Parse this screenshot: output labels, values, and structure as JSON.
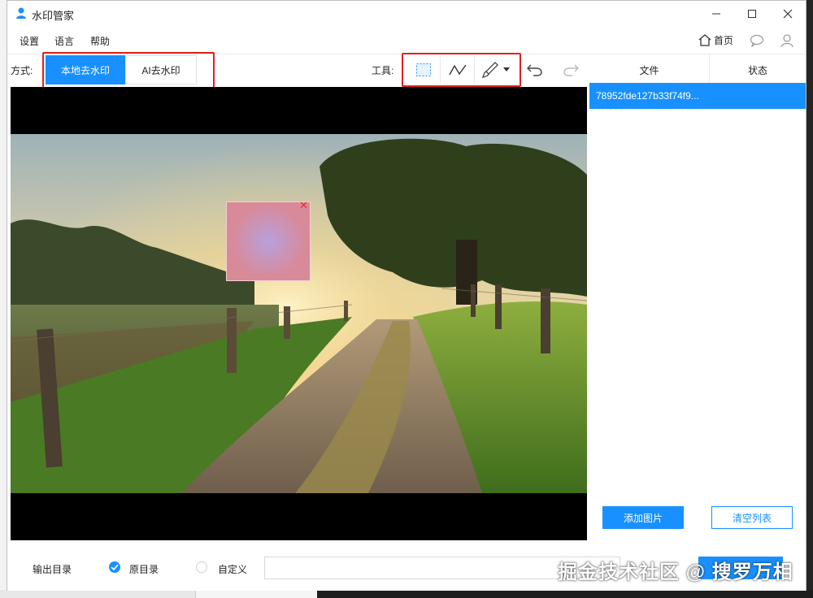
{
  "window": {
    "title": "水印管家"
  },
  "menu": {
    "settings": "设置",
    "language": "语言",
    "help": "帮助",
    "home": "首页"
  },
  "mode": {
    "label": "方式:",
    "local": "本地去水印",
    "ai": "AI去水印"
  },
  "tools": {
    "label": "工具:",
    "icons": [
      "rect-select-icon",
      "polyline-icon",
      "brush-icon",
      "undo-icon",
      "redo-icon"
    ]
  },
  "file_panel": {
    "col_file": "文件",
    "col_status": "状态",
    "files": [
      {
        "name": "78952fde127b33f74f9...",
        "status": ""
      }
    ],
    "add_button": "添加图片",
    "clear_button": "清空列表"
  },
  "output": {
    "label": "输出目录",
    "opt_original": "原目录",
    "opt_custom": "自定义",
    "selected": "原目录",
    "path_value": ""
  },
  "watermark": "掘金技术社区 @ 搜罗万相",
  "colors": {
    "accent": "#1890ff",
    "highlight_box": "#e02020",
    "selection_fill": "#d88a99"
  }
}
